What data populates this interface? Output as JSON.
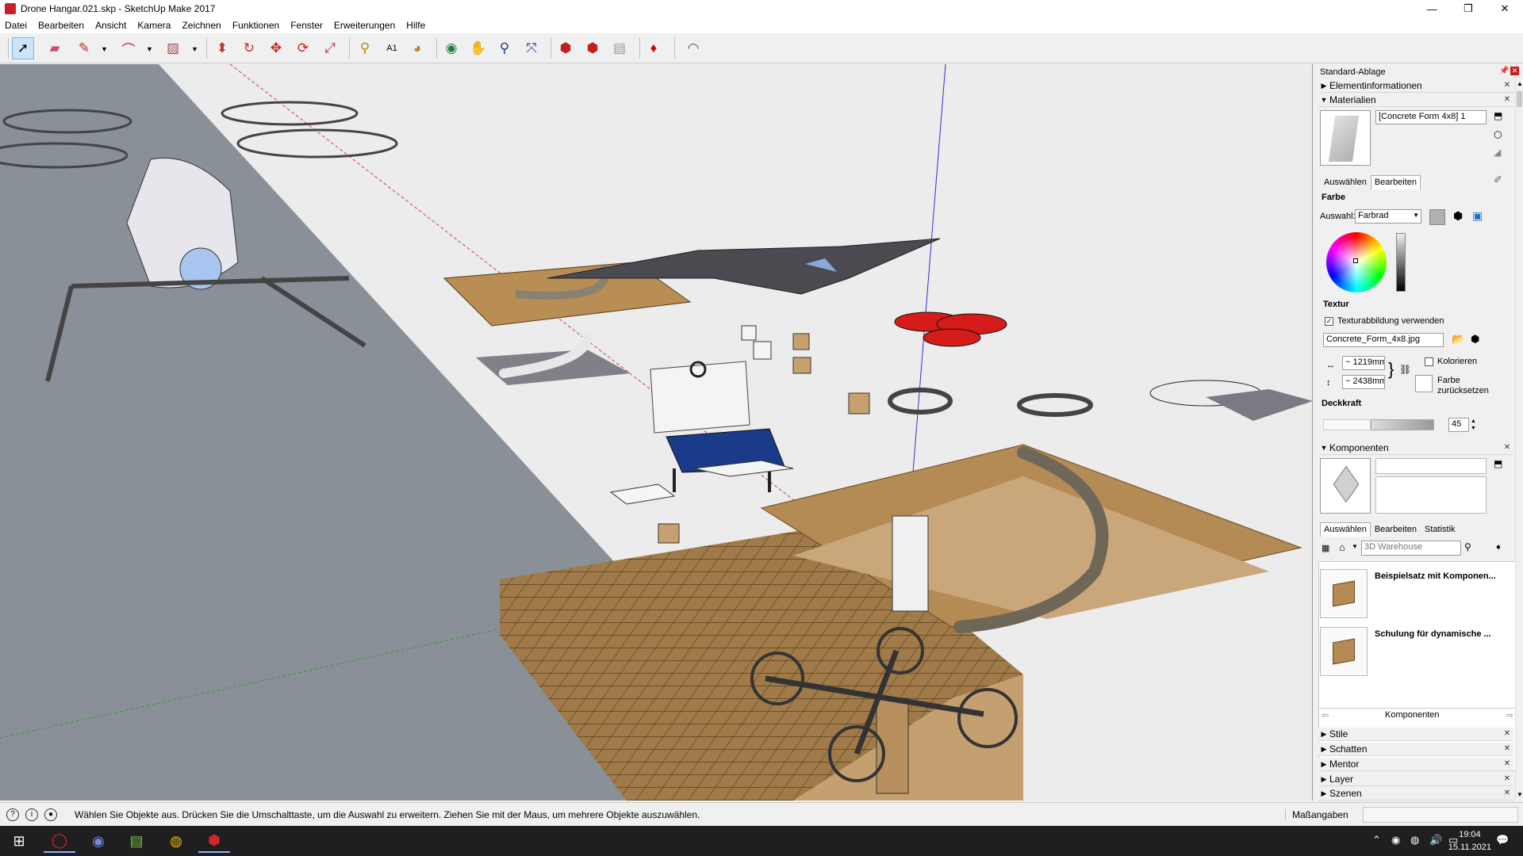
{
  "window": {
    "title": "Drone Hangar.021.skp - SketchUp Make 2017",
    "minimize": "—",
    "maximize": "❐",
    "close": "✕"
  },
  "menu": [
    "Datei",
    "Bearbeiten",
    "Ansicht",
    "Kamera",
    "Zeichnen",
    "Funktionen",
    "Fenster",
    "Erweiterungen",
    "Hilfe"
  ],
  "toolbar": {
    "tools": [
      "select-icon",
      "eraser-icon",
      "pencil-icon",
      "arc-icon",
      "rectangle-icon",
      "push-pull-icon",
      "follow-me-icon",
      "move-icon",
      "rotate-icon",
      "scale-icon",
      "tape-measure-icon",
      "text-icon",
      "paint-bucket-icon",
      "orbit-icon",
      "pan-icon",
      "zoom-icon",
      "zoom-extents-icon",
      "warehouse-icon",
      "extension-warehouse-icon",
      "layout-icon",
      "ruby-icon",
      "sandbox-icon"
    ]
  },
  "tray": {
    "title": "Standard-Ablage",
    "entity_info": "Elementinformationen",
    "materials": {
      "header": "Materialien",
      "material_name": "[Concrete Form 4x8] 1",
      "tab_select": "Auswählen",
      "tab_edit": "Bearbeiten",
      "color_section": "Farbe",
      "picker_label": "Auswahl:",
      "picker_value": "Farbrad",
      "texture_section": "Textur",
      "use_texture_label": "Texturabbildung verwenden",
      "use_texture_checked": true,
      "texture_file": "Concrete_Form_4x8.jpg",
      "width": "~ 1219mm",
      "height": "~ 2438mm",
      "colorize_label": "Kolorieren",
      "reset_color_label": "Farbe zurücksetzen",
      "opacity_section": "Deckkraft",
      "opacity_value": "45"
    },
    "components": {
      "header": "Komponenten",
      "tab_select": "Auswählen",
      "tab_edit": "Bearbeiten",
      "tab_stats": "Statistik",
      "search_placeholder": "3D Warehouse",
      "items": [
        {
          "label": "Beispielsatz mit Komponen..."
        },
        {
          "label": "Schulung für dynamische ..."
        }
      ],
      "footer_label": "Komponenten"
    },
    "collapsed_panels": [
      "Stile",
      "Schatten",
      "Mentor",
      "Layer",
      "Szenen"
    ]
  },
  "status": {
    "message": "Wählen Sie Objekte aus. Drücken Sie die Umschalttaste, um die Auswahl zu erweitern. Ziehen Sie mit der Maus, um mehrere Objekte auszuwählen.",
    "measurements_label": "Maßangaben"
  },
  "taskbar": {
    "time": "19:04",
    "date": "15.11.2021"
  },
  "colors": {
    "accent_blue": "#1a72d0",
    "drone_red": "#d61b1b",
    "floor_tile": "#a07a48",
    "ground": "#ececec",
    "strip": "#8a9098"
  }
}
